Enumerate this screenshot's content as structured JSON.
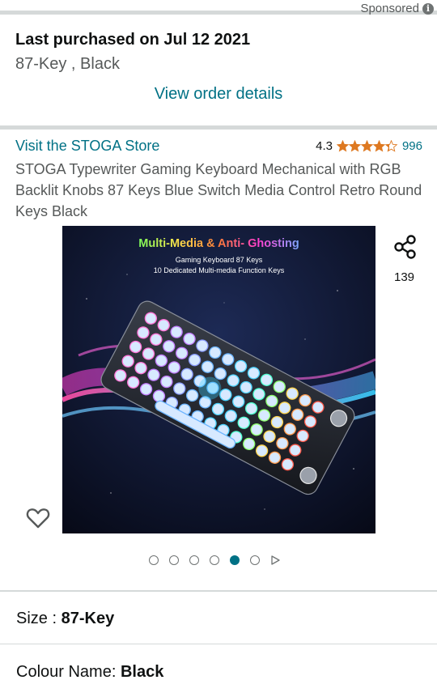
{
  "ad": {
    "sponsored_label": "Sponsored",
    "info_icon": "info-icon"
  },
  "purchase": {
    "last_purchased": "Last purchased on Jul 12 2021",
    "variant": "87-Key , Black",
    "view_order_label": "View order details"
  },
  "product": {
    "store_link": "Visit the STOGA Store",
    "rating_value": "4.3",
    "stars_filled": 4.3,
    "review_count": "996",
    "title": "STOGA Typewriter Gaming Keyboard Mechanical with RGB Backlit Knobs 87 Keys Blue Switch Media Control Retro Round Keys Black",
    "share_count": "139",
    "image": {
      "headline_part1": "Multi-Media & Anti- Ghosting",
      "subline1": "Gaming Keyboard 87 Keys",
      "subline2": "10 Dedicated Multi-media Function Keys"
    },
    "carousel": {
      "total": 6,
      "active_index": 5
    }
  },
  "options": {
    "size_label": "Size :",
    "size_value": "87-Key",
    "colour_label": "Colour Name:",
    "colour_value": "Black"
  },
  "colors": {
    "link": "#007185",
    "star": "#de7921",
    "divider": "#d5d9d9"
  }
}
